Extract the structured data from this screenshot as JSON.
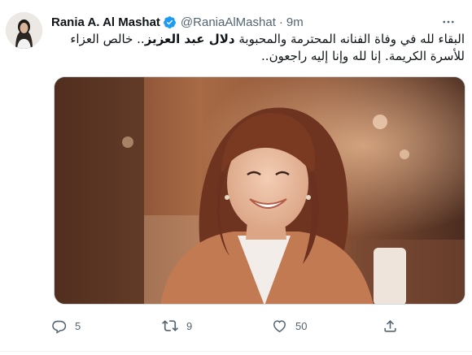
{
  "author": {
    "display_name": "Rania A. Al Mashat",
    "handle": "@RaniaAlMashat",
    "separator": "·",
    "time": "9m",
    "verified": true
  },
  "tweet": {
    "line1_prefix": "البقاء لله في وفاة الفنانه المحترمة والمحبوبة",
    "line1_bold": "دلال عبد العزيز",
    "line1_suffix": ".. خالص العزاء",
    "line2": "للأسرة الكريمة. إنا لله وإنا إليه راجعون.."
  },
  "actions": {
    "reply_count": "5",
    "retweet_count": "9",
    "like_count": "50"
  },
  "colors": {
    "verified_blue": "#1d9bf0",
    "secondary_text": "#536471"
  }
}
